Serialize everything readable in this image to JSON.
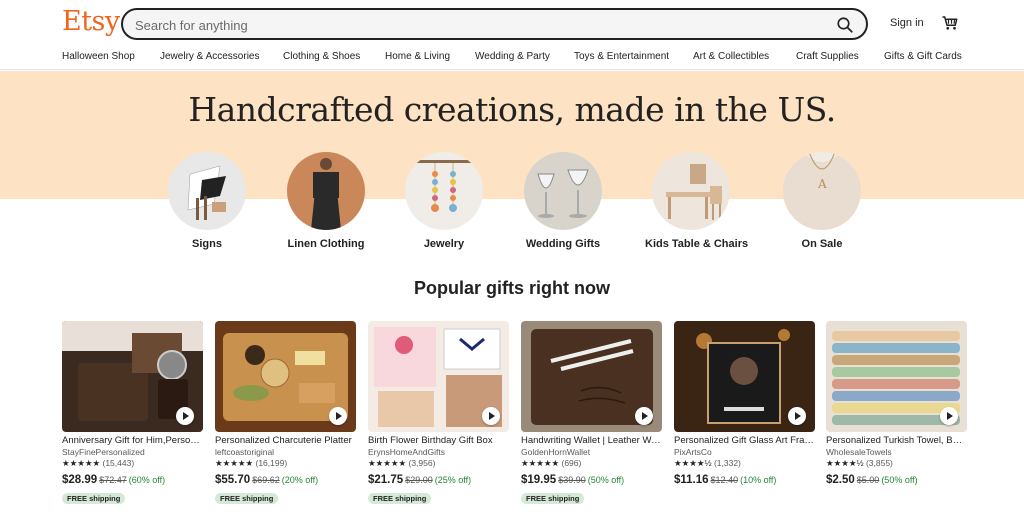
{
  "header": {
    "logo": "Etsy",
    "search_placeholder": "Search for anything",
    "signin": "Sign in",
    "accent": "#f1641e"
  },
  "nav": [
    "Halloween Shop",
    "Jewelry & Accessories",
    "Clothing & Shoes",
    "Home & Living",
    "Wedding & Party",
    "Toys & Entertainment",
    "Art & Collectibles",
    "Craft Supplies",
    "Gifts & Gift Cards"
  ],
  "hero": {
    "title": "Handcrafted creations, made in the US.",
    "band_color": "#fde3c3",
    "categories": [
      {
        "label": "Signs"
      },
      {
        "label": "Linen Clothing"
      },
      {
        "label": "Jewelry"
      },
      {
        "label": "Wedding Gifts"
      },
      {
        "label": "Kids Table & Chairs"
      },
      {
        "label": "On Sale"
      }
    ]
  },
  "popular": {
    "title": "Popular gifts right now",
    "products": [
      {
        "title": "Anniversary Gift for Him,Personalized Wallet",
        "shop": "StayFinePersonalized",
        "stars": "★★★★★",
        "reviews": "(15,443)",
        "price": "$28.99",
        "original": "$72.47",
        "discount": "(60% off)",
        "badge": "FREE shipping"
      },
      {
        "title": "Personalized Charcuterie Platter",
        "shop": "leftcoastoriginal",
        "stars": "★★★★★",
        "reviews": "(16,199)",
        "price": "$55.70",
        "original": "$69.62",
        "discount": "(20% off)",
        "badge": "FREE shipping"
      },
      {
        "title": "Birth Flower Birthday Gift Box",
        "shop": "ErynsHomeAndGifts",
        "stars": "★★★★★",
        "reviews": "(3,956)",
        "price": "$21.75",
        "original": "$29.00",
        "discount": "(25% off)",
        "badge": "FREE shipping"
      },
      {
        "title": "Handwriting Wallet | Leather Wallet",
        "shop": "GoldenHornWallet",
        "stars": "★★★★★",
        "reviews": "(696)",
        "price": "$19.95",
        "original": "$39.90",
        "discount": "(50% off)",
        "badge": "FREE shipping"
      },
      {
        "title": "Personalized Gift Glass Art Frame",
        "shop": "PixArtsCo",
        "stars": "★★★★½",
        "reviews": "(1,332)",
        "price": "$11.16",
        "original": "$12.40",
        "discount": "(10% off)",
        "badge": ""
      },
      {
        "title": "Personalized Turkish Towel, Beach",
        "shop": "WholesaleTowels",
        "stars": "★★★★½",
        "reviews": "(3,855)",
        "price": "$2.50",
        "original": "$5.00",
        "discount": "(50% off)",
        "badge": ""
      }
    ]
  }
}
